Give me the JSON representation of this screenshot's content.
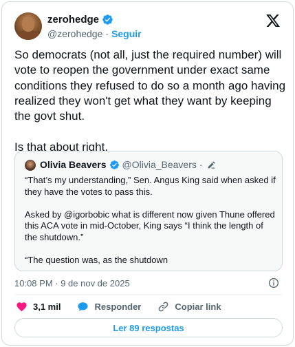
{
  "header": {
    "display_name": "zerohedge",
    "handle": "@zerohedge",
    "separator": "·",
    "follow_label": "Seguir"
  },
  "tweet": {
    "text": "So democrats (not all, just the required number) will vote to reopen the government under exact same conditions they refused to do so a month ago having realized they won't get what they want by keeping the govt shut.\n\nIs that about right."
  },
  "quote": {
    "display_name": "Olivia Beavers",
    "handle": "@Olivia_Beavers",
    "separator": "·",
    "text": "“That’s my understanding,” Sen. Angus King said when asked if they have the votes to pass this.\n\nAsked by @igorbobic what is different now given Thune offered this ACA vote in mid-October, King says “I think the length of the shutdown.”\n\n“The question was, as the shutdown"
  },
  "meta": {
    "timestamp": "10:08 PM · 9 de nov de 2025"
  },
  "actions": {
    "likes_count": "3,1 mil",
    "reply_label": "Responder",
    "copy_link_label": "Copiar link"
  },
  "replies_button": {
    "label": "Ler 89 respostas"
  },
  "colors": {
    "accent": "#1d9bf0",
    "like": "#f91880",
    "text": "#0f1419",
    "secondary": "#536471",
    "border": "#cfd9de"
  },
  "icons": {
    "verified": "verified-badge-icon",
    "logo": "x-logo-icon",
    "info": "info-icon",
    "like": "heart-icon",
    "reply": "speech-bubble-icon",
    "copy": "link-icon",
    "edit": "pencil-icon"
  }
}
